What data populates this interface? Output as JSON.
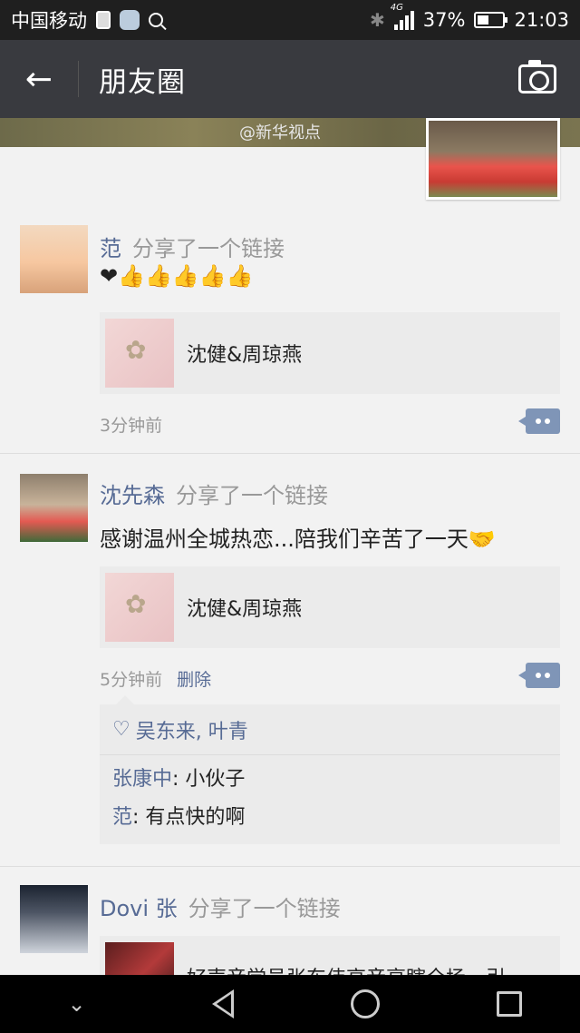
{
  "status_bar": {
    "carrier": "中国移动",
    "network": "4G",
    "battery": "37%",
    "time": "21:03"
  },
  "app_bar": {
    "title": "朋友圈"
  },
  "cover": {
    "watermark": "@新华视点"
  },
  "posts": [
    {
      "name": "范",
      "action": "分享了一个链接",
      "content": "❤👍👍👍👍👍",
      "link_title": "沈健&周琼燕",
      "time": "3分钟前"
    },
    {
      "name": "沈先森",
      "action": "分享了一个链接",
      "content": "感谢温州全城热恋...陪我们辛苦了一天🤝",
      "link_title": "沈健&周琼燕",
      "time": "5分钟前",
      "delete": "删除",
      "likes": "吴东来, 叶青",
      "comments": [
        {
          "who": "张康中",
          "text": "小伙子"
        },
        {
          "who": "范",
          "text": "有点快的啊"
        }
      ]
    },
    {
      "name": "Dovi 张",
      "action": "分享了一个链接",
      "link_title": "好声音学员张东伟高音亮瞎全场，引"
    }
  ],
  "colors": {
    "link_blue": "#576b95",
    "app_bar": "#393a3f",
    "status_bar": "#1f1f1f"
  },
  "icons": {
    "back": "arrow-left-icon",
    "camera": "camera-icon",
    "more": "more-dots-icon",
    "like": "heart-icon"
  }
}
